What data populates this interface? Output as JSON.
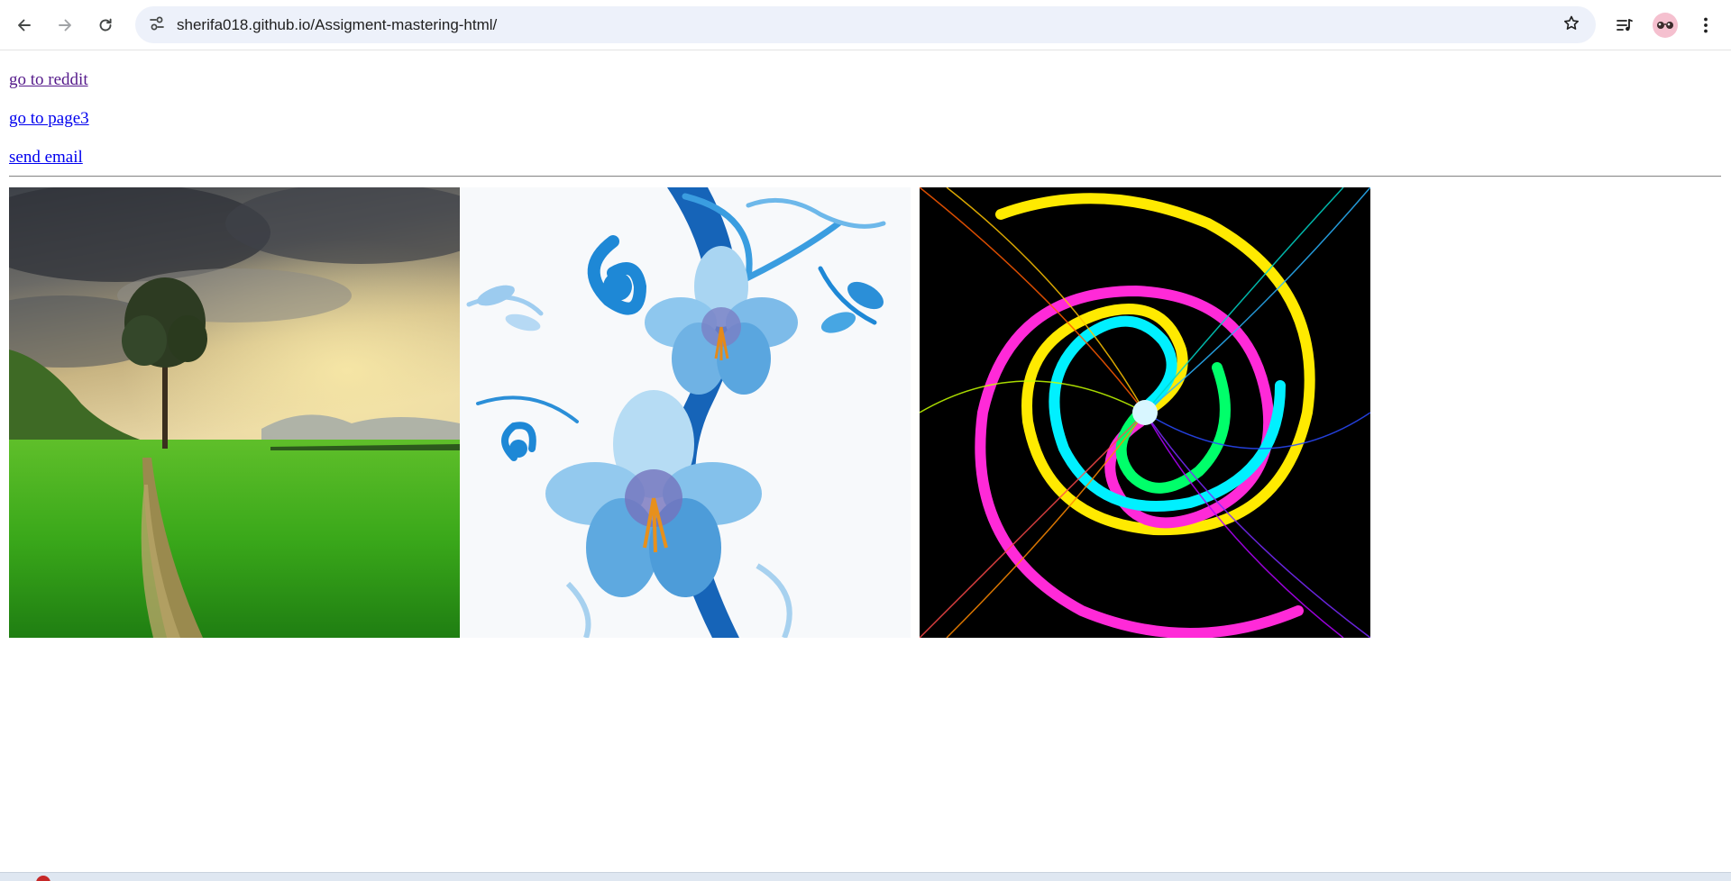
{
  "browser": {
    "url": "sherifa018.github.io/Assigment-mastering-html/",
    "buttons": {
      "back_icon": "arrow-left-icon",
      "forward_icon": "arrow-right-icon",
      "reload_icon": "reload-icon",
      "site_info_icon": "tune-icon",
      "bookmark_icon": "star-outline-icon",
      "media_icon": "media-queue-icon",
      "profile_icon": "profile-avatar-icon",
      "menu_icon": "three-dot-menu-icon"
    },
    "colors": {
      "omnibox_bg": "#edf1fa",
      "avatar_bg": "#f5c0cf"
    }
  },
  "page": {
    "links": [
      {
        "label": "go to reddit",
        "visited": true
      },
      {
        "label": "go to page3",
        "visited": false
      },
      {
        "label": "send email",
        "visited": false
      }
    ],
    "images": [
      {
        "subject": "green field with tree under stormy sky"
      },
      {
        "subject": "blue floral lily illustration"
      },
      {
        "subject": "rainbow spiral"
      }
    ],
    "colors": {
      "link": "#0000ee",
      "visited_link": "#551a8b"
    }
  }
}
